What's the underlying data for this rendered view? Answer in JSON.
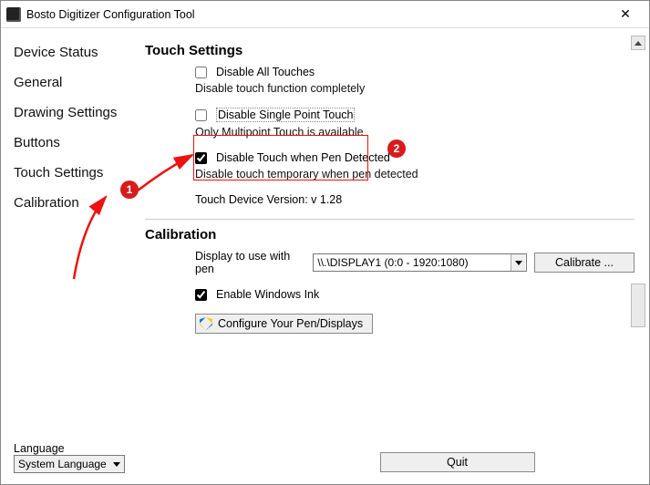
{
  "titlebar": {
    "title": "Bosto Digitizer Configuration Tool"
  },
  "sidebar": {
    "items": [
      "Device Status",
      "General",
      "Drawing Settings",
      "Buttons",
      "Touch Settings",
      "Calibration"
    ]
  },
  "language": {
    "label": "Language",
    "value": "System Language"
  },
  "touch_settings": {
    "heading": "Touch Settings",
    "disable_all": {
      "label": "Disable All Touches",
      "checked": false,
      "desc": "Disable touch function completely"
    },
    "disable_single": {
      "label": "Disable Single Point Touch",
      "checked": false,
      "desc": "Only Multipoint Touch is available"
    },
    "disable_on_pen": {
      "label": "Disable Touch when Pen Detected",
      "checked": true,
      "desc": "Disable touch temporary when pen detected"
    },
    "version_label": "Touch Device Version: v 1.28"
  },
  "calibration": {
    "heading": "Calibration",
    "display_label": "Display to use with pen",
    "display_value": "\\\\.\\DISPLAY1 (0:0 - 1920:1080)",
    "calibrate_button": "Calibrate ...",
    "enable_ink": {
      "label": "Enable Windows Ink",
      "checked": true
    },
    "configure_button": "Configure Your Pen/Displays"
  },
  "bottom": {
    "quit": "Quit"
  },
  "annotations": {
    "badge1": "1",
    "badge2": "2"
  }
}
